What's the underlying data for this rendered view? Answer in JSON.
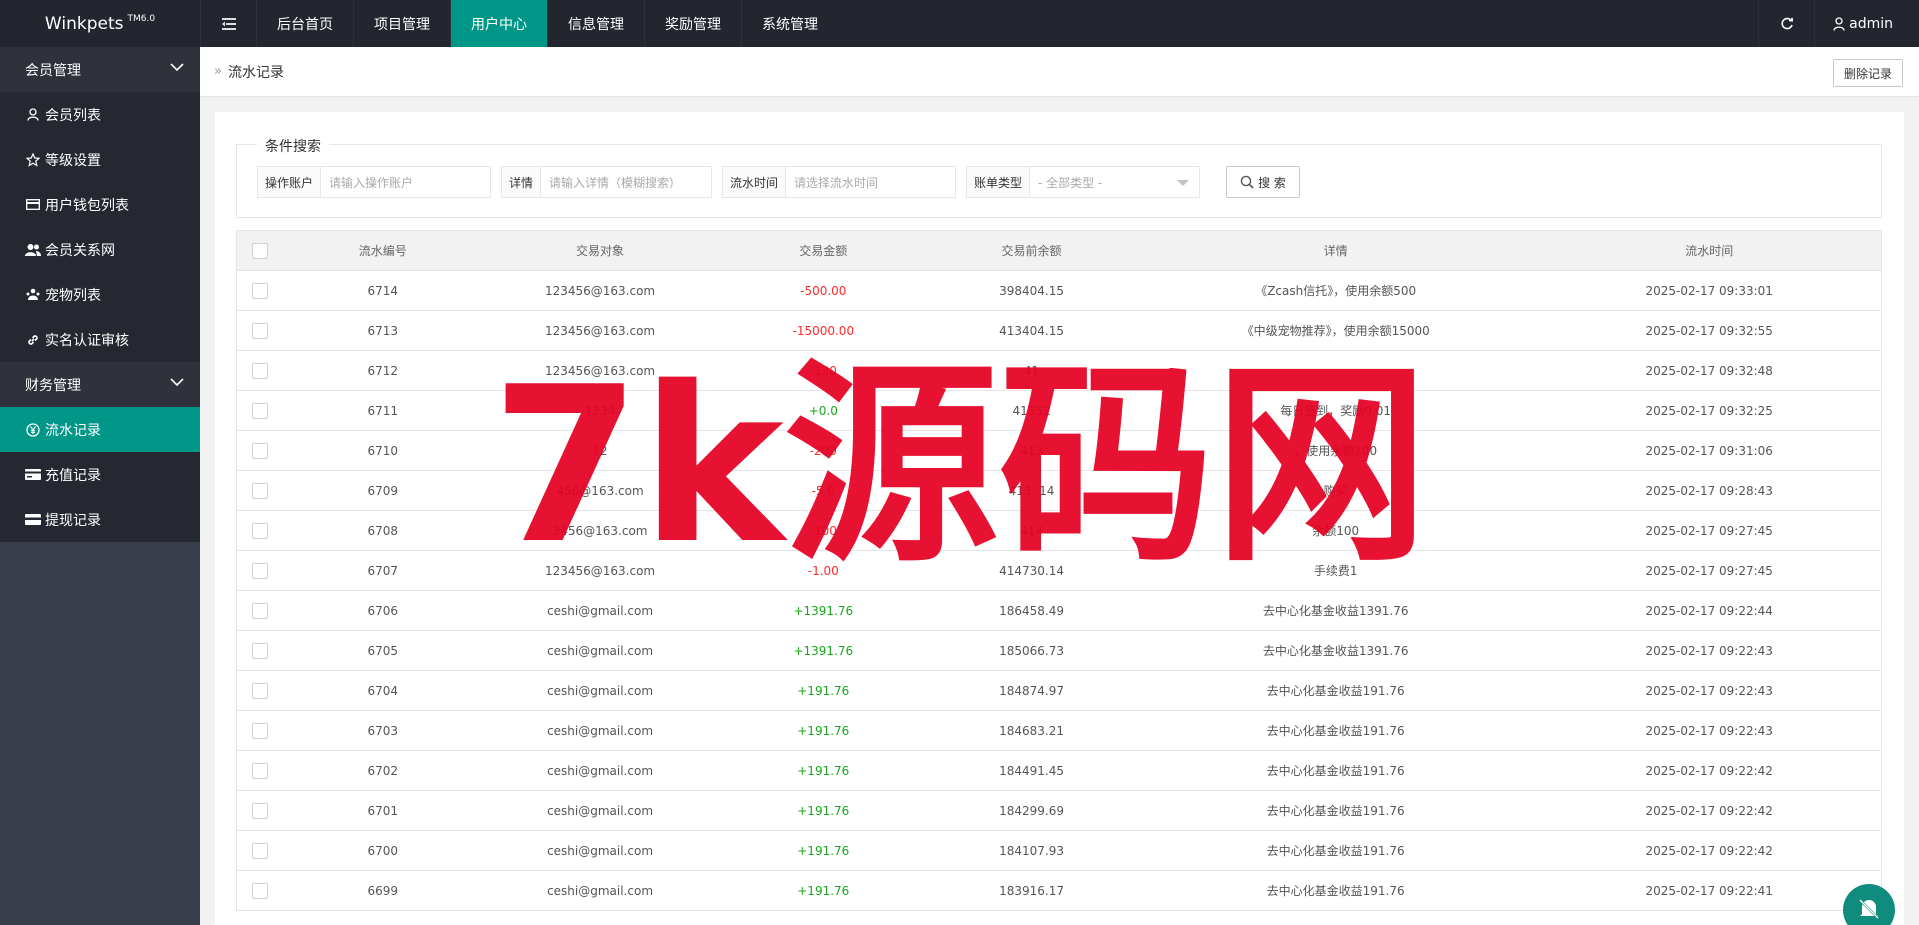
{
  "app": {
    "logo": "Winkpets",
    "version": "TM6.0"
  },
  "topnav": {
    "items": [
      {
        "label": "后台首页",
        "active": false
      },
      {
        "label": "项目管理",
        "active": false
      },
      {
        "label": "用户中心",
        "active": true
      },
      {
        "label": "信息管理",
        "active": false
      },
      {
        "label": "奖励管理",
        "active": false
      },
      {
        "label": "系统管理",
        "active": false
      }
    ],
    "user": "admin"
  },
  "sidebar": {
    "groups": [
      {
        "label": "会员管理",
        "items": [
          {
            "label": "会员列表",
            "icon": "user-icon"
          },
          {
            "label": "等级设置",
            "icon": "star-icon"
          },
          {
            "label": "用户钱包列表",
            "icon": "wallet-icon"
          },
          {
            "label": "会员关系网",
            "icon": "users-icon"
          },
          {
            "label": "宠物列表",
            "icon": "pet-icon"
          },
          {
            "label": "实名认证审核",
            "icon": "link-icon"
          }
        ]
      },
      {
        "label": "财务管理",
        "items": [
          {
            "label": "流水记录",
            "icon": "yen-icon",
            "active": true
          },
          {
            "label": "充值记录",
            "icon": "card-icon"
          },
          {
            "label": "提现记录",
            "icon": "card-icon"
          }
        ]
      }
    ]
  },
  "breadcrumb": {
    "sep": "»",
    "title": "流水记录"
  },
  "actions": {
    "delete_label": "删除记录"
  },
  "search": {
    "legend": "条件搜索",
    "fields": [
      {
        "label": "操作账户",
        "placeholder": "请输入操作账户"
      },
      {
        "label": "详情",
        "placeholder": "请输入详情（模糊搜索）"
      },
      {
        "label": "流水时间",
        "placeholder": "请选择流水时间"
      },
      {
        "label": "账单类型",
        "placeholder": "- 全部类型 -"
      }
    ],
    "button_label": "搜 索"
  },
  "table": {
    "headers": [
      "流水编号",
      "交易对象",
      "交易金额",
      "交易前余额",
      "详情",
      "流水时间"
    ],
    "rows": [
      {
        "id": "6714",
        "target": "123456@163.com",
        "amount": "-500.00",
        "before": "398404.15",
        "detail": "《Zcash信托》，使用余额500",
        "time": "2025-02-17 09:33:01"
      },
      {
        "id": "6713",
        "target": "123456@163.com",
        "amount": "-15000.00",
        "before": "413404.15",
        "detail": "《中级宠物推荐》，使用余额15000",
        "time": "2025-02-17 09:32:55"
      },
      {
        "id": "6712",
        "target": "123456@163.com",
        "amount": "-120",
        "before": "41",
        "detail": "",
        "time": "2025-02-17 09:32:48"
      },
      {
        "id": "6711",
        "target": "1234",
        "amount": "+0.0",
        "before": "41352",
        "detail": "每日签到，奖励0.01",
        "time": "2025-02-17 09:32:25"
      },
      {
        "id": "6710",
        "target": "12",
        "amount": "-200",
        "before": "413",
        "detail": "，使用余额200",
        "time": "2025-02-17 09:31:06"
      },
      {
        "id": "6709",
        "target": "456@163.com",
        "amount": "-5.0",
        "before": "413 .14",
        "detail": "购买",
        "time": "2025-02-17 09:28:43"
      },
      {
        "id": "6708",
        "target": "3456@163.com",
        "amount": "-100",
        "before": "414",
        "detail": "余额100",
        "time": "2025-02-17 09:27:45"
      },
      {
        "id": "6707",
        "target": "123456@163.com",
        "amount": "-1.00",
        "before": "414730.14",
        "detail": "手续费1",
        "time": "2025-02-17 09:27:45"
      },
      {
        "id": "6706",
        "target": "ceshi@gmail.com",
        "amount": "+1391.76",
        "before": "186458.49",
        "detail": "去中心化基金收益1391.76",
        "time": "2025-02-17 09:22:44"
      },
      {
        "id": "6705",
        "target": "ceshi@gmail.com",
        "amount": "+1391.76",
        "before": "185066.73",
        "detail": "去中心化基金收益1391.76",
        "time": "2025-02-17 09:22:43"
      },
      {
        "id": "6704",
        "target": "ceshi@gmail.com",
        "amount": "+191.76",
        "before": "184874.97",
        "detail": "去中心化基金收益191.76",
        "time": "2025-02-17 09:22:43"
      },
      {
        "id": "6703",
        "target": "ceshi@gmail.com",
        "amount": "+191.76",
        "before": "184683.21",
        "detail": "去中心化基金收益191.76",
        "time": "2025-02-17 09:22:43"
      },
      {
        "id": "6702",
        "target": "ceshi@gmail.com",
        "amount": "+191.76",
        "before": "184491.45",
        "detail": "去中心化基金收益191.76",
        "time": "2025-02-17 09:22:42"
      },
      {
        "id": "6701",
        "target": "ceshi@gmail.com",
        "amount": "+191.76",
        "before": "184299.69",
        "detail": "去中心化基金收益191.76",
        "time": "2025-02-17 09:22:42"
      },
      {
        "id": "6700",
        "target": "ceshi@gmail.com",
        "amount": "+191.76",
        "before": "184107.93",
        "detail": "去中心化基金收益191.76",
        "time": "2025-02-17 09:22:42"
      },
      {
        "id": "6699",
        "target": "ceshi@gmail.com",
        "amount": "+191.76",
        "before": "183916.17",
        "detail": "去中心化基金收益191.76",
        "time": "2025-02-17 09:22:41"
      }
    ]
  },
  "watermark": "7k源码网",
  "colors": {
    "accent": "#009688",
    "topbar": "#23262e",
    "sidebar": "#393d49",
    "negative": "#ff2a2a",
    "positive": "#1aa61a",
    "watermark": "#e60023"
  }
}
